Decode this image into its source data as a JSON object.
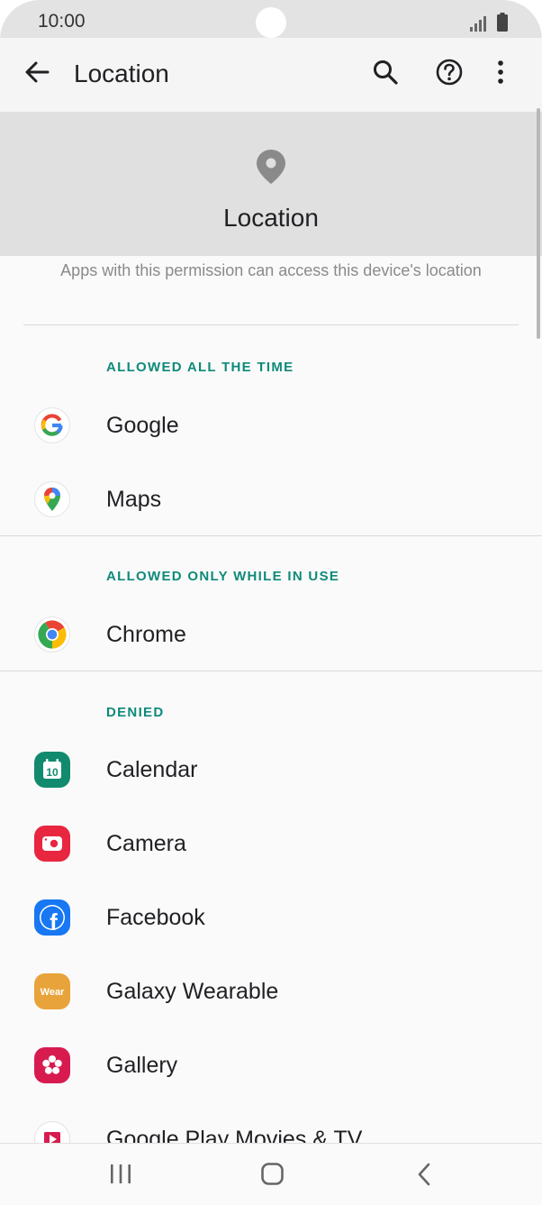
{
  "status_bar": {
    "time": "10:00"
  },
  "app_bar": {
    "title": "Location"
  },
  "hero": {
    "title": "Location"
  },
  "description": "Apps with this permission can access this device's location",
  "sections": [
    {
      "header": "ALLOWED ALL THE TIME",
      "apps": [
        {
          "name": "Google",
          "icon": "google-icon"
        },
        {
          "name": "Maps",
          "icon": "maps-icon"
        }
      ]
    },
    {
      "header": "ALLOWED ONLY WHILE IN USE",
      "apps": [
        {
          "name": "Chrome",
          "icon": "chrome-icon"
        }
      ]
    },
    {
      "header": "DENIED",
      "apps": [
        {
          "name": "Calendar",
          "icon": "calendar-icon",
          "icon_text": "10"
        },
        {
          "name": "Camera",
          "icon": "camera-icon"
        },
        {
          "name": "Facebook",
          "icon": "facebook-icon",
          "icon_text": "f"
        },
        {
          "name": "Galaxy Wearable",
          "icon": "wear-icon",
          "icon_text": "Wear"
        },
        {
          "name": "Gallery",
          "icon": "gallery-icon"
        },
        {
          "name": "Google Play Movies & TV",
          "icon": "play-movies-icon"
        }
      ]
    }
  ],
  "colors": {
    "accent": "#0f8a7a",
    "calendar": "#128a6e",
    "camera": "#e8263f",
    "facebook": "#1877f2",
    "wear": "#e8a33a",
    "gallery": "#d81b4f"
  }
}
